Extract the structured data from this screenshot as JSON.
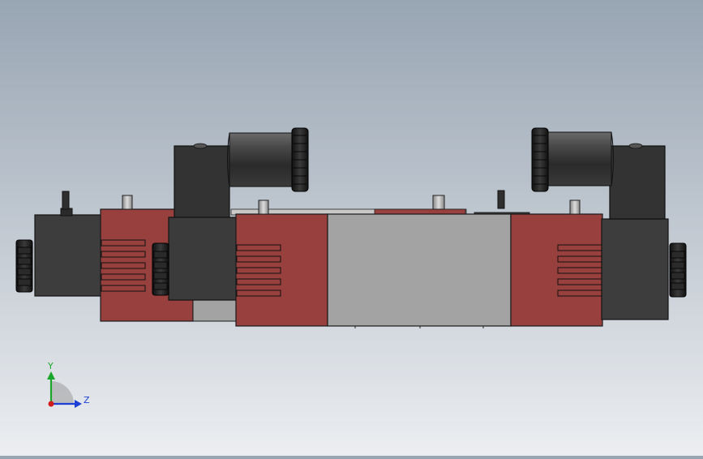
{
  "viewport": {
    "background_top": "#98a5b3",
    "background_bottom": "#eceef1"
  },
  "model": {
    "body_red": "#98403d",
    "body_gray": "#a3a3a3",
    "solenoid_dark": "#3c3c3c",
    "connector_dark": "#333333",
    "knob_black": "#1c1c1c"
  },
  "triad": {
    "y_label": "Y",
    "z_label": "Z",
    "y_color": "#1aa62a",
    "z_color": "#1c3fd6",
    "x_color": "#d21c1c"
  }
}
